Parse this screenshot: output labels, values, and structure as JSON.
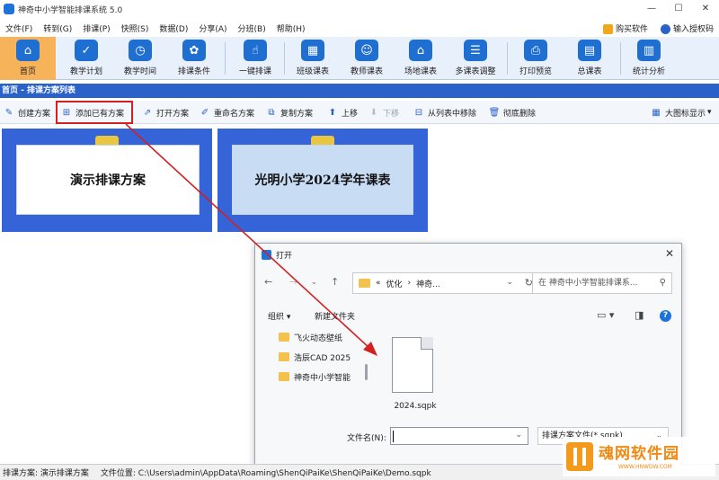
{
  "window": {
    "title": "神奇中小学智能排课系统 5.0",
    "controls": [
      "—",
      "☐",
      "✕"
    ]
  },
  "menu": {
    "items": [
      "文件(F)",
      "转到(G)",
      "排课(P)",
      "快照(S)",
      "数据(D)",
      "分享(A)",
      "分班(B)",
      "帮助(H)"
    ],
    "buy": "购买软件",
    "license": "输入授权码"
  },
  "main_toolbar": {
    "items": [
      {
        "label": "首页",
        "icon": "home-icon"
      },
      {
        "label": "教学计划",
        "icon": "clipboard-icon"
      },
      {
        "label": "教学时间",
        "icon": "clock-icon"
      },
      {
        "label": "排课条件",
        "icon": "settings-icon"
      },
      {
        "label": "一键排课",
        "icon": "hand-pointer-icon"
      },
      {
        "label": "班级课表",
        "icon": "grid-icon"
      },
      {
        "label": "教师课表",
        "icon": "teacher-icon"
      },
      {
        "label": "场地课表",
        "icon": "building-icon"
      },
      {
        "label": "多课表调整",
        "icon": "adjust-icon"
      },
      {
        "label": "打印预览",
        "icon": "printer-icon"
      },
      {
        "label": "总课表",
        "icon": "calendar-icon"
      },
      {
        "label": "统计分析",
        "icon": "chart-icon"
      }
    ]
  },
  "breadcrumb": "首页 - 排课方案列表",
  "sub_toolbar": {
    "create": "创建方案",
    "add_existing": "添加已有方案",
    "open": "打开方案",
    "rename": "重命名方案",
    "copy": "复制方案",
    "move_up": "上移",
    "move_down": "下移",
    "remove_from_list": "从列表中移除",
    "delete": "彻底删除",
    "view_mode": "大图标显示"
  },
  "plans": [
    {
      "name": "演示排课方案"
    },
    {
      "name": "光明小学2024学年课表"
    }
  ],
  "open_dialog": {
    "title": "打开",
    "path": [
      "«",
      "优化",
      "›",
      "神奇..."
    ],
    "search_placeholder": "在 神奇中小学智能排课系...",
    "organize": "组织 ▾",
    "new_folder": "新建文件夹",
    "tree": [
      "飞火动态壁纸",
      "浩辰CAD 2025",
      "神奇中小学智能"
    ],
    "file": {
      "name": "2024.sqpk"
    },
    "filename_label": "文件名(N):",
    "filename_value": "",
    "filetype": "排课方案文件(*.sqpk)"
  },
  "status": {
    "plan": "排课方案: 演示排课方案",
    "location": "文件位置: C:\\Users\\admin\\AppData\\Roaming\\ShenQiPaiKe\\ShenQiPaiKe\\Demo.sqpk"
  },
  "watermark": {
    "text": "魂网软件园",
    "sub": "WWW.HNWDW.COM"
  },
  "colors": {
    "accent": "#2a62c9",
    "active_tab": "#f6b35a",
    "card_bg": "#3563d8",
    "highlight": "#d32020"
  }
}
